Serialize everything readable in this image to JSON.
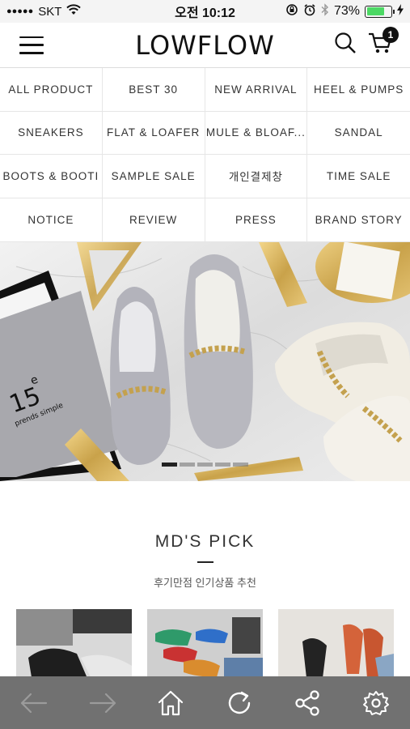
{
  "status_bar": {
    "signal": "●●●●●",
    "carrier": "SKT",
    "time": "오전 10:12",
    "battery_percent": "73%",
    "battery_level": 0.73
  },
  "header": {
    "logo": "LOWFLOW",
    "cart_count": "1",
    "icons": [
      "hamburger-menu-icon",
      "search-icon",
      "cart-icon"
    ]
  },
  "menu": {
    "items": [
      "ALL PRODUCT",
      "BEST 30",
      "NEW ARRIVAL",
      "HEEL & PUMPS",
      "SNEAKERS",
      "FLAT & LOAFER",
      "MULE & BLOAF...",
      "SANDAL",
      "BOOTS & BOOTI",
      "SAMPLE SALE",
      "개인결제창",
      "TIME SALE",
      "NOTICE",
      "REVIEW",
      "PRESS",
      "BRAND STORY"
    ]
  },
  "banner": {
    "card_text_big": "15",
    "card_text_sup": "e",
    "card_text_small": "prends simple",
    "slide_count": 5,
    "active_slide": 1
  },
  "mds_pick": {
    "title": "MD'S PICK",
    "subtitle": "후기만점 인기상품 추천"
  },
  "toolbar": {
    "icons": [
      "back-arrow-icon",
      "forward-arrow-icon",
      "home-icon",
      "refresh-icon",
      "share-icon",
      "settings-gear-icon"
    ]
  },
  "colors": {
    "toolbar_bg": "#717171",
    "battery_green": "#4cd964",
    "accent": "#111111"
  }
}
